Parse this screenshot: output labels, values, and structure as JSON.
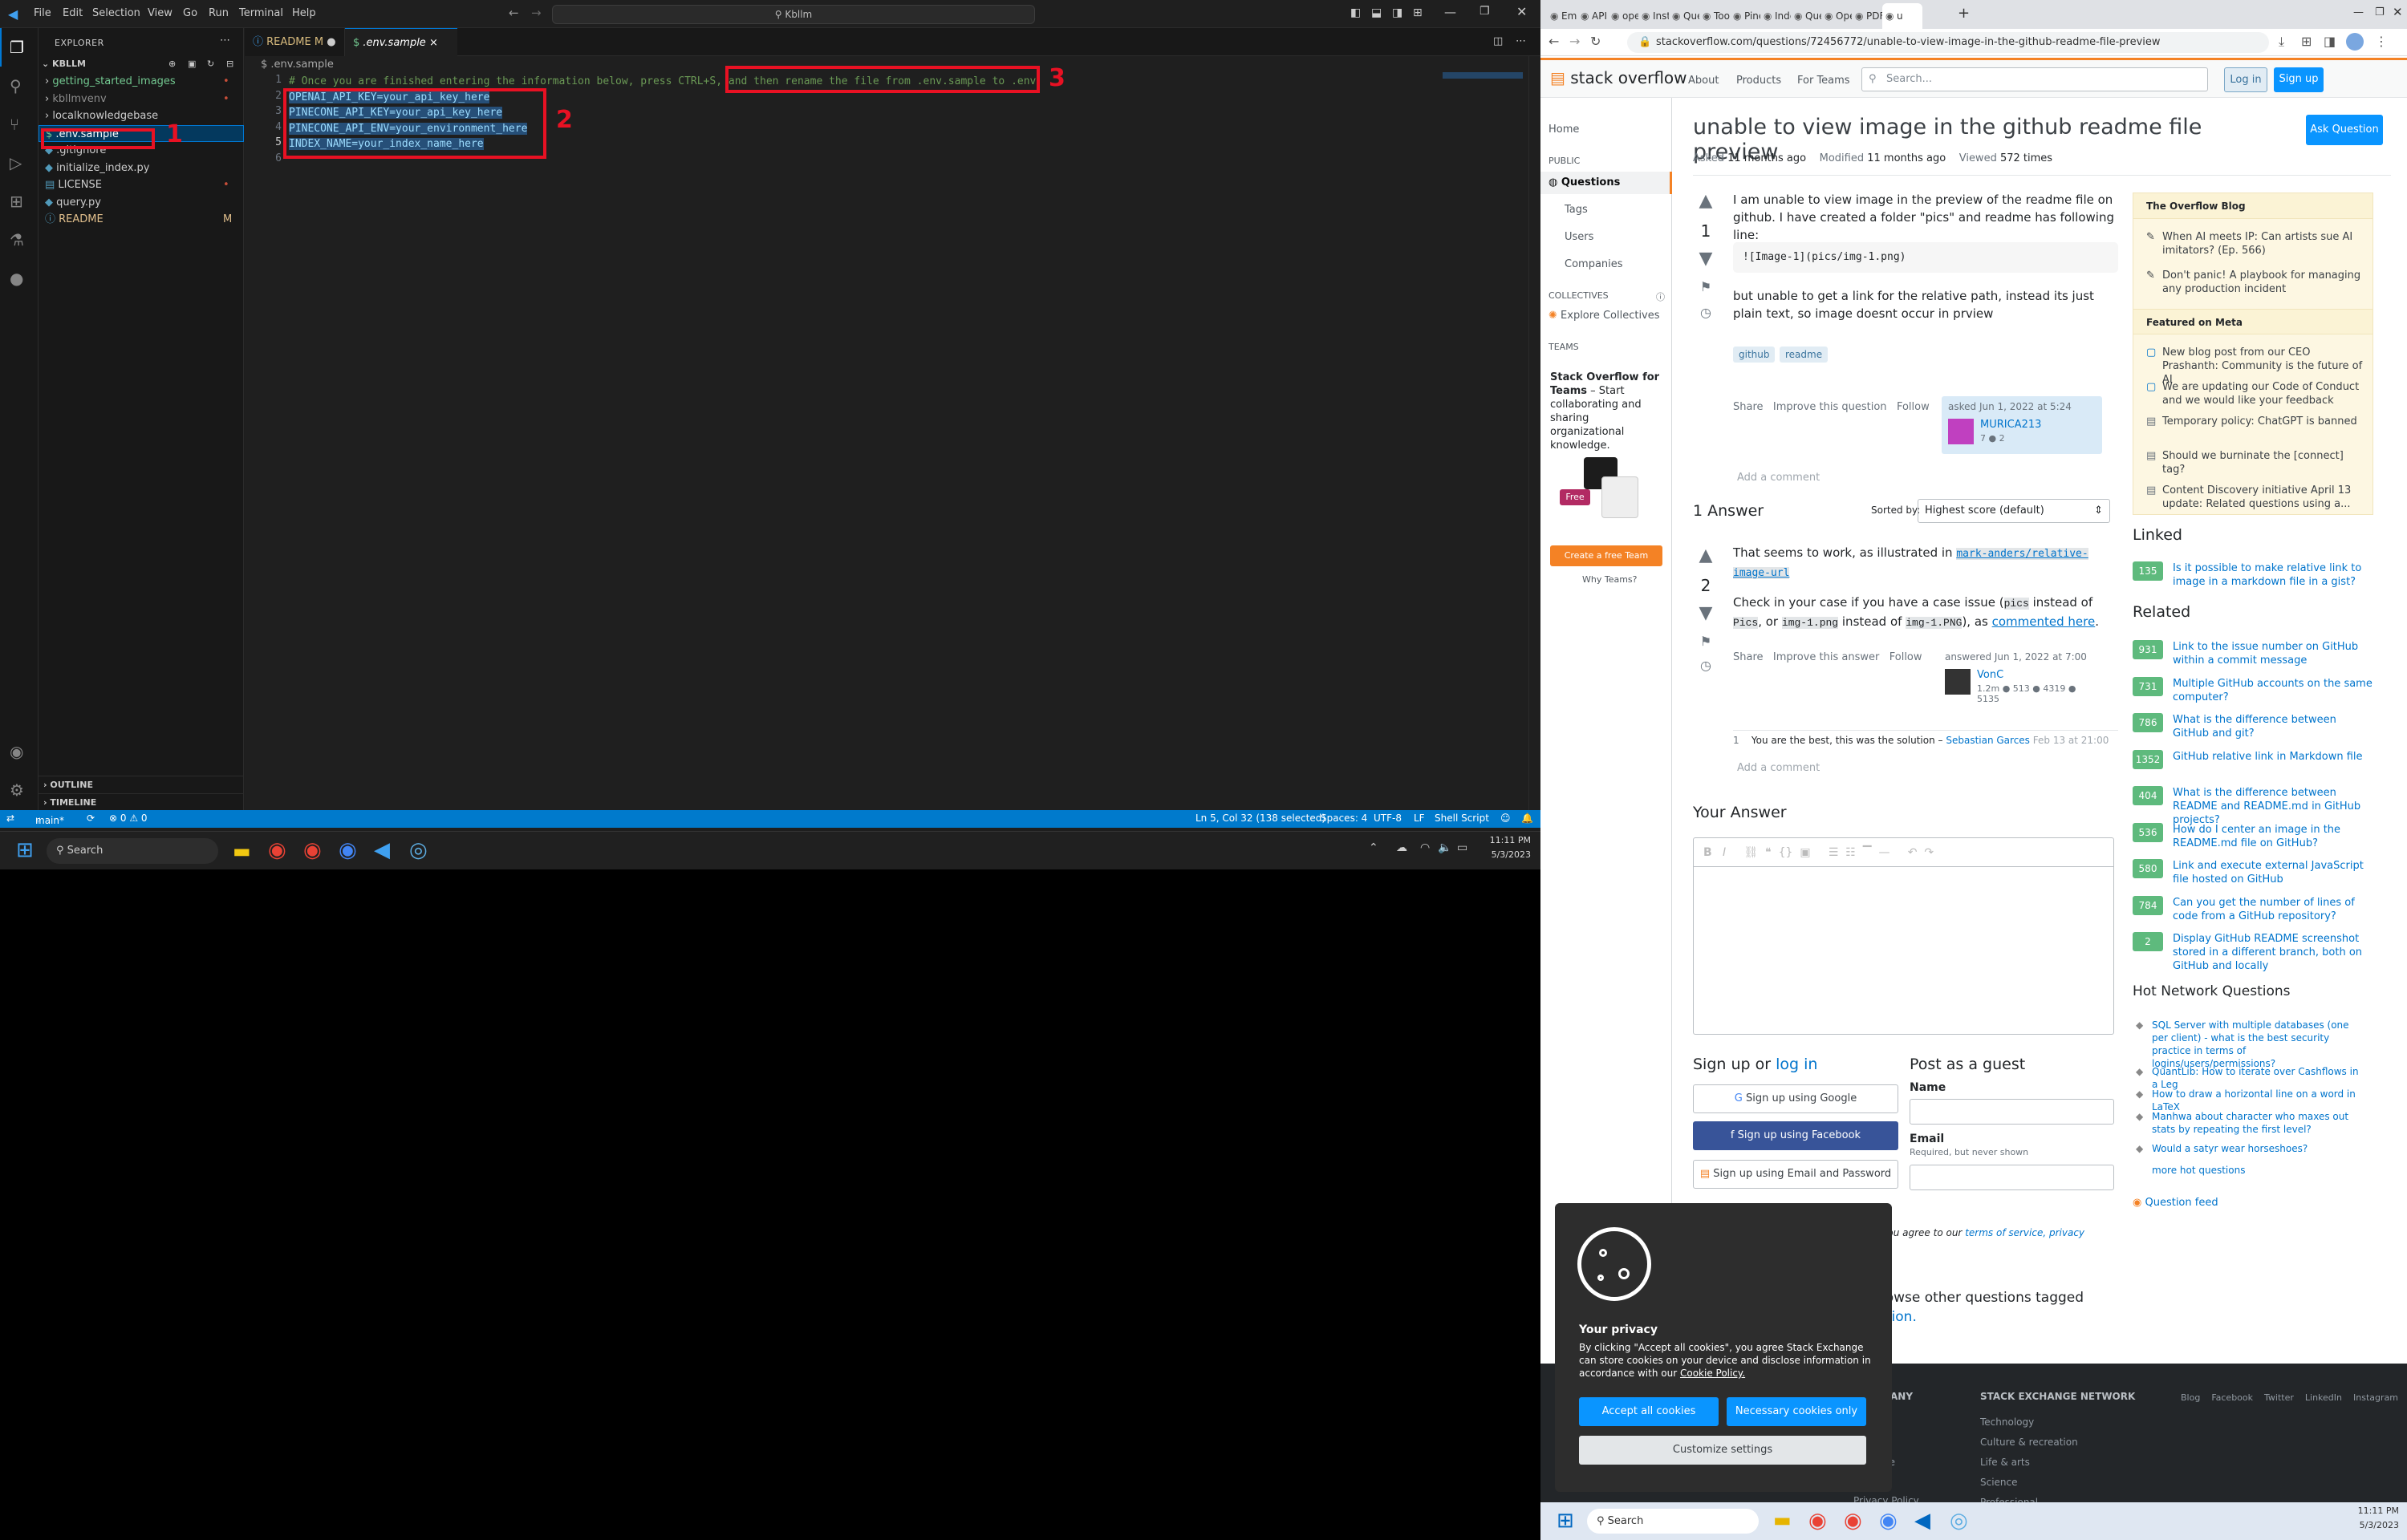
{
  "vscode": {
    "menu": [
      "File",
      "Edit",
      "Selection",
      "View",
      "Go",
      "Run",
      "Terminal",
      "Help"
    ],
    "search_text": "Kbllm",
    "explorer_title": "EXPLORER",
    "root_folder": "KBLLM",
    "tree": [
      {
        "label": "getting_started_images",
        "type": "folder",
        "color": "#73c991",
        "mark": "•"
      },
      {
        "label": "kbllmvenv",
        "type": "folder",
        "color": "#8c8c8c",
        "mark": "•"
      },
      {
        "label": "localknowledgebase",
        "type": "folder",
        "color": "#ccc",
        "mark": ""
      },
      {
        "label": ".env.sample",
        "type": "file",
        "icon": "$",
        "color": "#fff",
        "mark": ""
      },
      {
        "label": ".gitignore",
        "type": "file",
        "icon": "◆",
        "color": "#ccc",
        "mark": ""
      },
      {
        "label": "initialize_index.py",
        "type": "file",
        "icon": "◆",
        "color": "#ccc",
        "mark": ""
      },
      {
        "label": "LICENSE",
        "type": "file",
        "icon": "▤",
        "color": "#ccc",
        "mark": "•"
      },
      {
        "label": "query.py",
        "type": "file",
        "icon": "◆",
        "color": "#ccc",
        "mark": ""
      },
      {
        "label": "README",
        "type": "file",
        "icon": "ⓘ",
        "color": "#e2c08d",
        "mark": "M"
      }
    ],
    "outline": "OUTLINE",
    "timeline": "TIMELINE",
    "tabs": [
      {
        "label": "README",
        "mod": "M"
      },
      {
        "label": ".env.sample",
        "mod": "×"
      }
    ],
    "breadcrumb": "$ .env.sample",
    "code": [
      "# Once you are finished entering the information below, press CTRL+S, and then rename the file from .env.sample to .env",
      "OPENAI_API_KEY=your_api_key_here",
      "PINECONE_API_KEY=your_api_key_here",
      "PINECONE_API_ENV=your_environment_here",
      "INDEX_NAME=your_index_name_here",
      ""
    ],
    "annotations": [
      "1",
      "2",
      "3"
    ],
    "status": {
      "branch": "main*",
      "errors": "⊗ 0 ⚠ 0",
      "position": "Ln 5, Col 32 (138 selected)",
      "spaces": "Spaces: 4",
      "encoding": "UTF-8",
      "eol": "LF",
      "language": "Shell Script"
    }
  },
  "taskbar_left": {
    "search": "Search",
    "time": "11:11 PM",
    "date": "5/3/2023"
  },
  "browser": {
    "tabs": [
      "Emb",
      "API I",
      "ope",
      "Instr",
      "Que",
      "Tool",
      "Pine",
      "Inde",
      "Que",
      "Ope",
      "PDF",
      "u"
    ],
    "url": "stackoverflow.com/questions/72456772/unable-to-view-image-in-the-github-readme-file-preview",
    "so": {
      "logo": "stack overflow",
      "nav": [
        "About",
        "Products",
        "For Teams"
      ],
      "search_placeholder": "Search...",
      "login": "Log in",
      "signup": "Sign up"
    },
    "leftnav": {
      "home": "Home",
      "public": "PUBLIC",
      "questions": "Questions",
      "tags": "Tags",
      "users": "Users",
      "companies": "Companies",
      "collectives": "COLLECTIVES",
      "explore": "Explore Collectives",
      "teams": "TEAMS",
      "teams_title": "Stack Overflow for Teams",
      "teams_text": "– Start collaborating and sharing organizational knowledge.",
      "free": "Free",
      "create_team": "Create a free Team",
      "why_teams": "Why Teams?"
    },
    "question": {
      "title": "unable to view image in the github readme file preview",
      "ask": "Ask Question",
      "asked": "Asked",
      "asked_val": "11 months ago",
      "modified": "Modified",
      "modified_val": "11 months ago",
      "viewed": "Viewed",
      "viewed_val": "572 times",
      "votes": "1",
      "body1": "I am unable to view image in the preview of the readme file on github. I have created a folder \"pics\" and readme has following line:",
      "code": "![Image-1](pics/img-1.png)",
      "body2": "but unable to get a link for the relative path, instead its just plain text, so image doesnt occur in prview",
      "tags": [
        "github",
        "readme"
      ],
      "actions": [
        "Share",
        "Improve this question",
        "Follow"
      ],
      "asked_card": "asked Jun 1, 2022 at 5:24",
      "user": "MURICA213",
      "rep": "7 ● 2",
      "add_comment": "Add a comment"
    },
    "answers": {
      "count": "1 Answer",
      "sorted_by": "Sorted by:",
      "sort_value": "Highest score (default)",
      "votes": "2",
      "text1": "That seems to work, as illustrated in",
      "link1": "mark-anders/relative-image-url",
      "text2a": "Check in your case if you have a case issue (",
      "c1": "pics",
      "text2b": "instead of",
      "c2": "Pics",
      "text2c": ", or",
      "c3": "img-1.png",
      "text2d": "instead of",
      "c4": "img-1.PNG",
      "text2e": "), as",
      "link2": "commented here",
      "actions": [
        "Share",
        "Improve this answer",
        "Follow"
      ],
      "answered": "answered Jun 1, 2022 at 7:00",
      "user": "VonC",
      "rep": "1.2m ● 513 ● 4319 ● 5135",
      "comment_num": "1",
      "comment": "You are the best, this was the solution –",
      "comment_user": "Sebastian Garces",
      "comment_date": "Feb 13 at 21:00",
      "add_comment": "Add a comment"
    },
    "your_answer": "Your Answer",
    "signup": {
      "title_a": "Sign up or",
      "title_b": "log in",
      "google": "Sign up using Google",
      "facebook": "Sign up using Facebook",
      "email": "Sign up using Email and Password",
      "guest": "Post as a guest",
      "name": "Name",
      "email_label": "Email",
      "email_note": "Required, but never shown",
      "agree": "wer\", you agree to our",
      "terms": "terms of service, privacy",
      "browse": "r? Browse other questions tagged",
      "question_link": "question."
    },
    "blog": {
      "title": "The Overflow Blog",
      "items": [
        "When AI meets IP: Can artists sue AI imitators? (Ep. 566)",
        "Don't panic! A playbook for managing any production incident"
      ],
      "meta_title": "Featured on Meta",
      "meta": [
        "New blog post from our CEO Prashanth: Community is the future of AI",
        "We are updating our Code of Conduct and we would like your feedback",
        "Temporary policy: ChatGPT is banned",
        "Should we burninate the [connect] tag?",
        "Content Discovery initiative April 13 update: Related questions using a..."
      ]
    },
    "linked": {
      "title": "Linked",
      "items": [
        {
          "n": "135",
          "t": "Is it possible to make relative link to image in a markdown file in a gist?"
        }
      ]
    },
    "related": {
      "title": "Related",
      "items": [
        {
          "n": "931",
          "t": "Link to the issue number on GitHub within a commit message"
        },
        {
          "n": "731",
          "t": "Multiple GitHub accounts on the same computer?"
        },
        {
          "n": "786",
          "t": "What is the difference between GitHub and git?"
        },
        {
          "n": "1352",
          "t": "GitHub relative link in Markdown file"
        },
        {
          "n": "404",
          "t": "What is the difference between README and README.md in GitHub projects?"
        },
        {
          "n": "536",
          "t": "How do I center an image in the README.md file on GitHub?"
        },
        {
          "n": "580",
          "t": "Link and execute external JavaScript file hosted on GitHub"
        },
        {
          "n": "784",
          "t": "Can you get the number of lines of code from a GitHub repository?"
        },
        {
          "n": "2",
          "t": "Display GitHub README screenshot stored in a different branch, both on GitHub and locally"
        }
      ]
    },
    "hot": {
      "title": "Hot Network Questions",
      "items": [
        "SQL Server with multiple databases (one per client) - what is the best security practice in terms of logins/users/permissions?",
        "QuantLib: How to iterate over Cashflows in a Leg",
        "How to draw a horizontal line on a word in LaTeX",
        "Manhwa about character who maxes out stats by repeating the first level?",
        "Would a satyr wear horseshoes?"
      ],
      "more": "more hot questions",
      "feed": "Question feed"
    },
    "footer": {
      "col": "ANY",
      "network": "STACK EXCHANGE NETWORK",
      "links": [
        "Technology",
        "Culture & recreation",
        "Life & arts",
        "Science",
        "Professional"
      ],
      "social": [
        "Blog",
        "Facebook",
        "Twitter",
        "LinkedIn",
        "Instagram"
      ],
      "re": "re",
      "privacy": "Privacy Policy"
    },
    "cookie": {
      "title": "Your privacy",
      "text": "By clicking \"Accept all cookies\", you agree Stack Exchange can store cookies on your device and disclose information in accordance with our",
      "policy": "Cookie Policy.",
      "accept": "Accept all cookies",
      "necessary": "Necessary cookies only",
      "customize": "Customize settings"
    }
  },
  "taskbar_right": {
    "search": "Search",
    "time": "11:11 PM",
    "date": "5/3/2023"
  }
}
